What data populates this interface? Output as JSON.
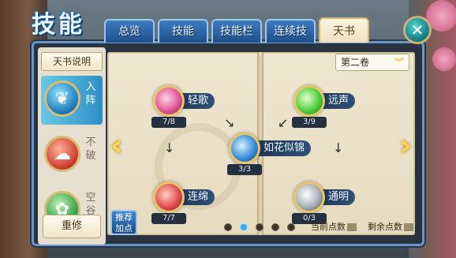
{
  "title": "技能",
  "tabs": [
    {
      "label": "总览",
      "active": false
    },
    {
      "label": "技能",
      "active": false
    },
    {
      "label": "技能栏",
      "active": false
    },
    {
      "label": "连续技",
      "active": false
    },
    {
      "label": "天书",
      "active": true
    }
  ],
  "left_panel": {
    "book_info": "天书说明",
    "formations": [
      {
        "label_1": "入",
        "label_2": "阵",
        "icon": "feather-icon",
        "active": true
      },
      {
        "label_1": "不",
        "label_2": "破",
        "icon": "cloud-swirl-icon",
        "active": false
      },
      {
        "label_1": "空",
        "label_2": "谷",
        "icon": "lotus-icon",
        "active": false
      }
    ],
    "reset": "重修"
  },
  "volume_select": "第二卷",
  "skills": [
    {
      "name": "轻歌",
      "level": "7/8",
      "color": "pink"
    },
    {
      "name": "远声",
      "level": "3/9",
      "color": "green"
    },
    {
      "name": "如花似锦",
      "level": "3/3",
      "color": "blue"
    },
    {
      "name": "连绵",
      "level": "7/7",
      "color": "red"
    },
    {
      "name": "通明",
      "level": "0/3",
      "color": "grey"
    }
  ],
  "recommend_button": {
    "line1": "推荐",
    "line2": "加点"
  },
  "pagination": {
    "total": 5,
    "active": 1
  },
  "points": {
    "current_label": "当前点数",
    "remaining_label": "剩余点数"
  },
  "colors": {
    "tab_blue": "#1e4f8a",
    "tab_active": "#fbf4e0",
    "page_bg": "#efe6d0",
    "accent_gold": "#e8c46a",
    "dot_active": "#33b0f0"
  }
}
